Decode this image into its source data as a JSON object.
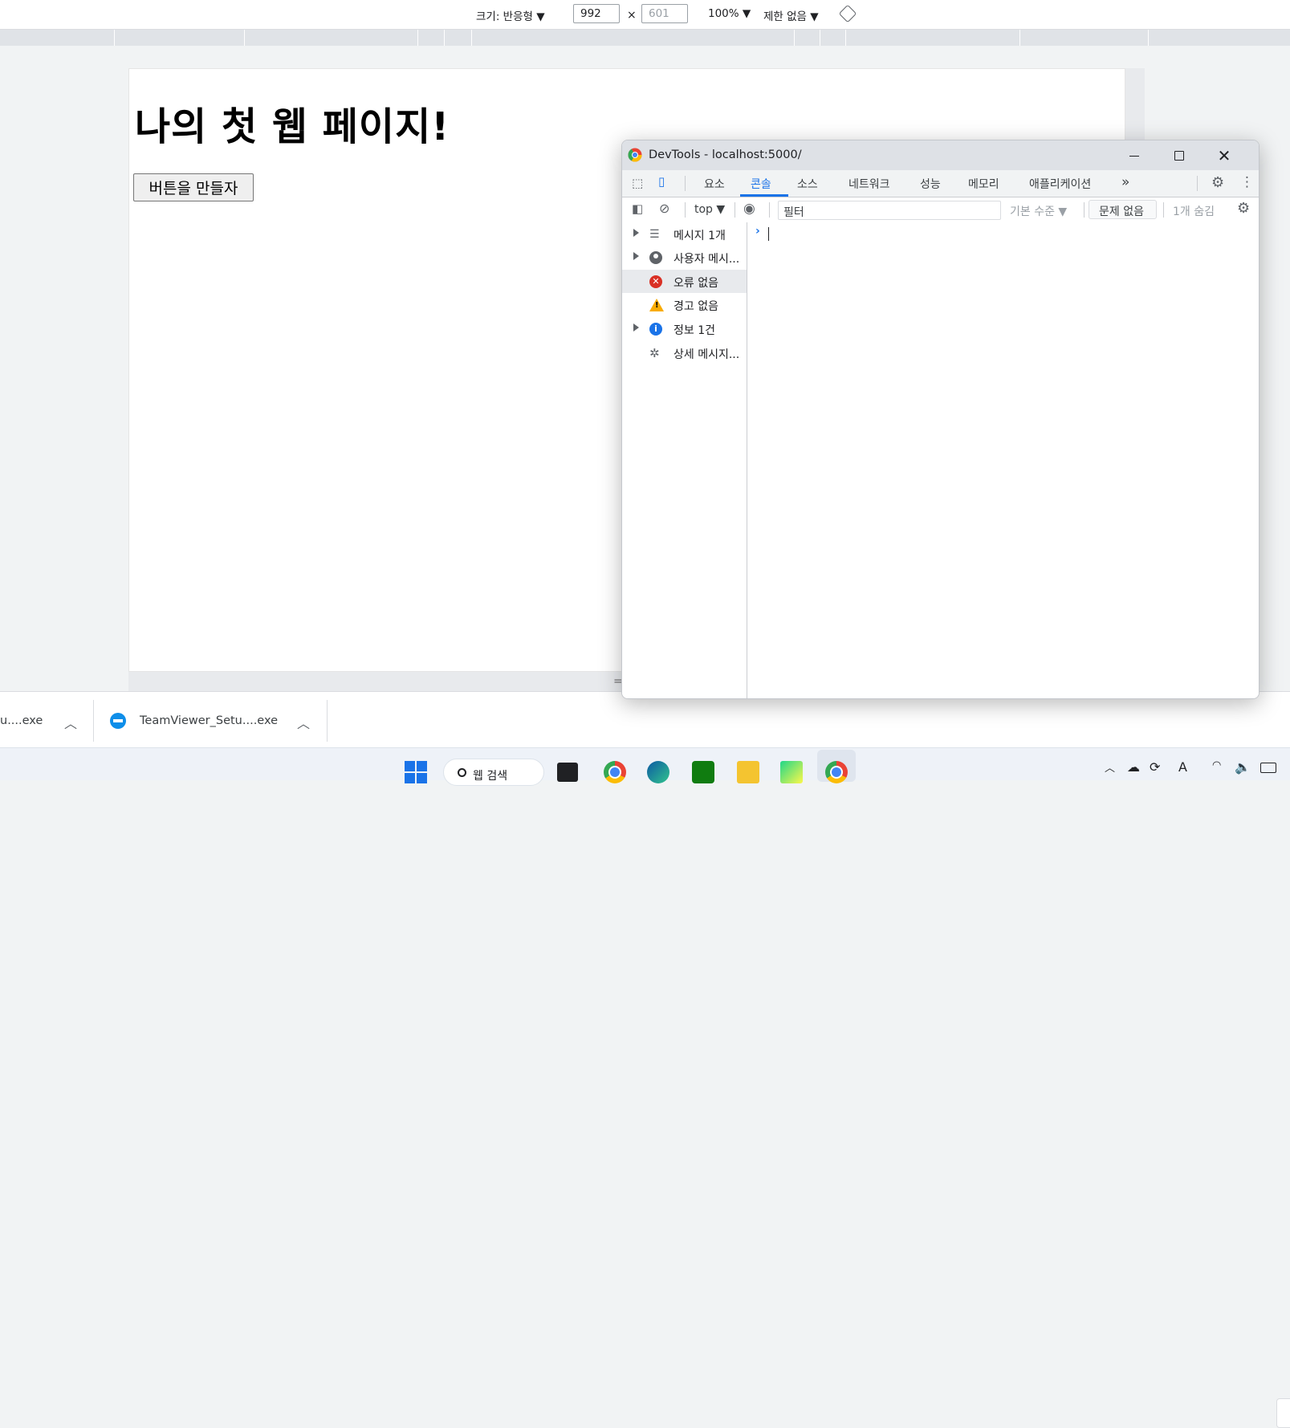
{
  "device_toolbar": {
    "dimensions_label": "크기: 반응형 ▼",
    "width_value": "992",
    "times": "×",
    "height_value": "601",
    "zoom": "100% ▼",
    "throttle": "제한 없음 ▼"
  },
  "page": {
    "heading": "나의 첫 웹 페이지!",
    "button_label": "버튼을 만들자",
    "resize_handle": "="
  },
  "devtools": {
    "title": "DevTools - localhost:5000/",
    "tabs": [
      "요소",
      "콘솔",
      "소스",
      "네트워크",
      "성능",
      "메모리",
      "애플리케이션"
    ],
    "active_tab": "콘솔",
    "more_tabs": "»",
    "toolbar": {
      "context": "top ▼",
      "filter_placeholder": "필터",
      "levels": "기본 수준 ▼",
      "issues": "문제 없음",
      "hidden": "1개 숨김"
    },
    "sidebar": [
      {
        "label": "메시지 1개",
        "icon": "list-icon",
        "expandable": true
      },
      {
        "label": "사용자 메시...",
        "icon": "user-icon",
        "expandable": true
      },
      {
        "label": "오류 없음",
        "icon": "error-icon",
        "expandable": false,
        "selected": true
      },
      {
        "label": "경고 없음",
        "icon": "warning-icon",
        "expandable": false
      },
      {
        "label": "정보 1건",
        "icon": "info-icon",
        "expandable": true
      },
      {
        "label": "상세 메시지...",
        "icon": "bug-icon",
        "expandable": false
      }
    ],
    "prompt": "›"
  },
  "downloads": {
    "item1": "u....exe",
    "item2": "TeamViewer_Setu....exe"
  },
  "taskbar": {
    "search_label": "웹 검색",
    "tray_ime": "A"
  },
  "colors": {
    "accent": "#1a73e8",
    "error": "#d93025",
    "warning": "#f9ab00"
  }
}
